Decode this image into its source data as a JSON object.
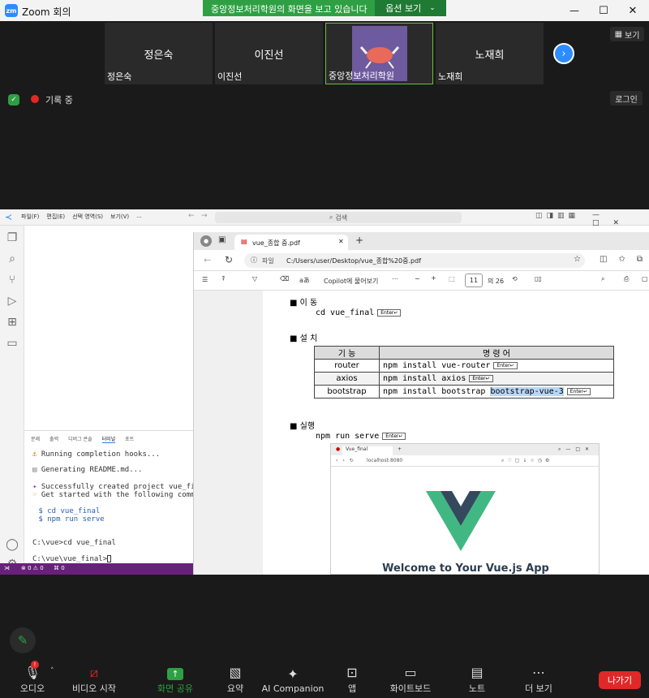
{
  "app_title": "Zoom 회의",
  "share_banner": {
    "text": "중앙정보처리학원의 화면을 보고 있습니다",
    "options_label": "옵션 보기"
  },
  "window_controls": {
    "minimize": "—",
    "maximize": "☐",
    "close": "✕"
  },
  "participants": [
    {
      "display": "정은숙",
      "label": "정은숙"
    },
    {
      "display": "이진선",
      "label": "이진선"
    },
    {
      "display": "",
      "label": "중앙정보처리학원"
    },
    {
      "display": "노재희",
      "label": "노재희"
    }
  ],
  "view_label": "보기",
  "recording_label": "기록 중",
  "logo_label": "로그인",
  "vscode": {
    "menu": [
      "파일(F)",
      "편집(E)",
      "선택 영역(S)",
      "보기(V)",
      "..."
    ],
    "search_placeholder": "검색",
    "panel_tabs": [
      "문제",
      "출력",
      "디버그 콘솔",
      "터미널",
      "포트"
    ],
    "terminal": [
      "Running completion hooks...",
      "Generating README.md...",
      "Successfully created project vue_final.",
      "Get started with the following commands:",
      " $ cd vue_final",
      " $ npm run serve",
      "C:\\vue>cd vue_final",
      "C:\\vue\\vue_final>"
    ],
    "status": {
      "errors": "0",
      "warnings": "0",
      "ports": "0"
    }
  },
  "browser": {
    "tab_title": "vue_종합 중.pdf",
    "url_prefix": "파일",
    "url": "C:/Users/user/Desktop/vue_종합%20중.pdf",
    "copilot": "Copilot에 물어보기",
    "page_current": "11",
    "page_total": "의 26"
  },
  "pdf": {
    "sec1_title": "이 동",
    "sec1_cmd": "cd vue_final",
    "sec2_title": "설 치",
    "table_head": [
      "기 능",
      "명 령 어"
    ],
    "rows": [
      {
        "feature": "router",
        "command": "npm install vue-router",
        "highlight": ""
      },
      {
        "feature": "axios",
        "command": "npm install axios",
        "highlight": ""
      },
      {
        "feature": "bootstrap",
        "command": "npm install bootstrap ",
        "highlight": "bootstrap-vue-3"
      }
    ],
    "sec3_title": "실행",
    "sec3_cmd": "npm run serve",
    "enter": "Enter↵",
    "preview_tab": "Vue_final",
    "preview_url": "localhost:8080",
    "preview_welcome": "Welcome to Your Vue.js App"
  },
  "toolbar": {
    "audio": "오디오",
    "video": "비디오 시작",
    "share": "화면 공유",
    "summary": "요약",
    "ai": "AI Companion",
    "apps": "앱",
    "whiteboard": "화이트보드",
    "notes": "노트",
    "more": "더 보기",
    "leave": "나가기"
  },
  "colors": {
    "accent_green": "#2ea043",
    "leave_red": "#e02828",
    "vscode_status": "#68217a",
    "vue_green": "#41b883",
    "vue_dark": "#35495e"
  }
}
